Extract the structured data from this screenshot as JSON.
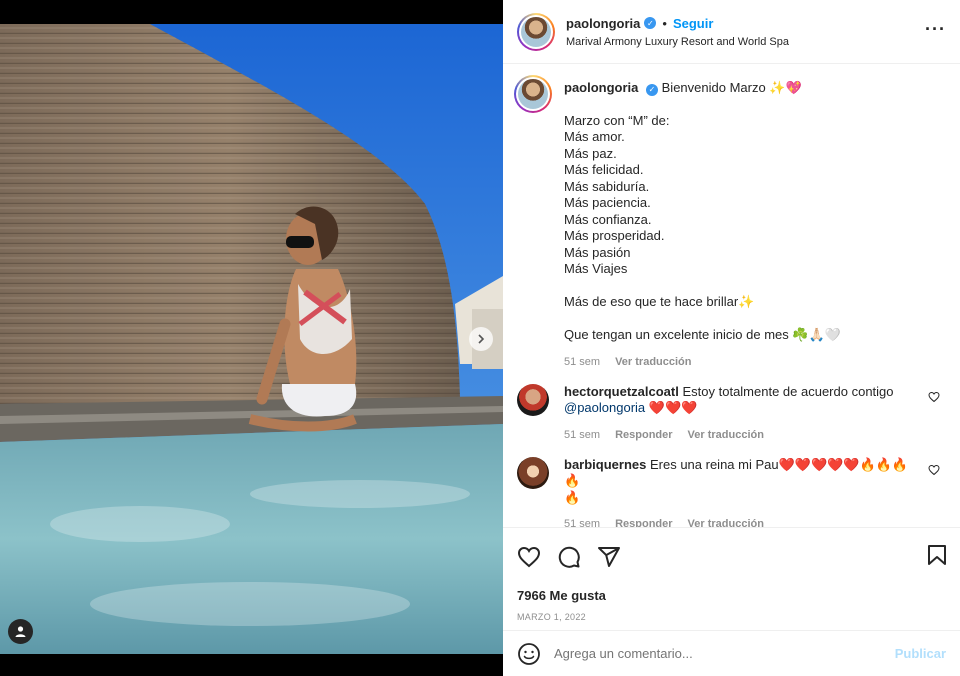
{
  "post": {
    "username": "paolongoria",
    "follow_label": "Seguir",
    "dot": "•",
    "location": "Marival Armony Luxury Resort and World Spa"
  },
  "caption": {
    "username": "paolongoria",
    "first_line": "Bienvenido Marzo ✨💖",
    "lines": [
      "Marzo con “M” de:",
      "Más amor.",
      "Más paz.",
      "Más felicidad.",
      "Más sabiduría.",
      "Más paciencia.",
      "Más confianza.",
      "Más prosperidad.",
      "Más pasión",
      "Más Viajes"
    ],
    "line_shine": "Más de eso que te hace brillar✨",
    "line_wish": "Que tengan un excelente inicio de mes ☘️🙏🏻🤍",
    "time": "51 sem",
    "translate": "Ver traducción"
  },
  "comments": [
    {
      "username": "hectorquetzalcoatl",
      "text": "Estoy totalmente de acuerdo contigo",
      "mention": "@paolongoria",
      "emojis": "❤️❤️❤️",
      "time": "51 sem",
      "reply": "Responder",
      "translate": "Ver traducción"
    },
    {
      "username": "barbiquernes",
      "text": "Eres una reina mi Pau❤️❤️❤️❤️❤️🔥🔥🔥🔥",
      "text_cont": "🔥",
      "time": "51 sem",
      "reply": "Responder",
      "translate": "Ver traducción"
    }
  ],
  "likes": "7966 Me gusta",
  "date": "MARZO 1, 2022",
  "add_comment": {
    "placeholder": "Agrega un comentario...",
    "post_label": "Publicar"
  },
  "icons": {
    "more": "more-options-icon",
    "like": "heart-icon",
    "comment": "comment-icon",
    "share": "share-icon",
    "save": "bookmark-icon",
    "emoji": "emoji-icon",
    "tags": "user-tag-icon",
    "next": "chevron-right-icon"
  },
  "colors": {
    "link": "#0095f6",
    "mention": "#00376b",
    "muted": "#8e8e8e",
    "post_disabled": "#b2dffc"
  }
}
